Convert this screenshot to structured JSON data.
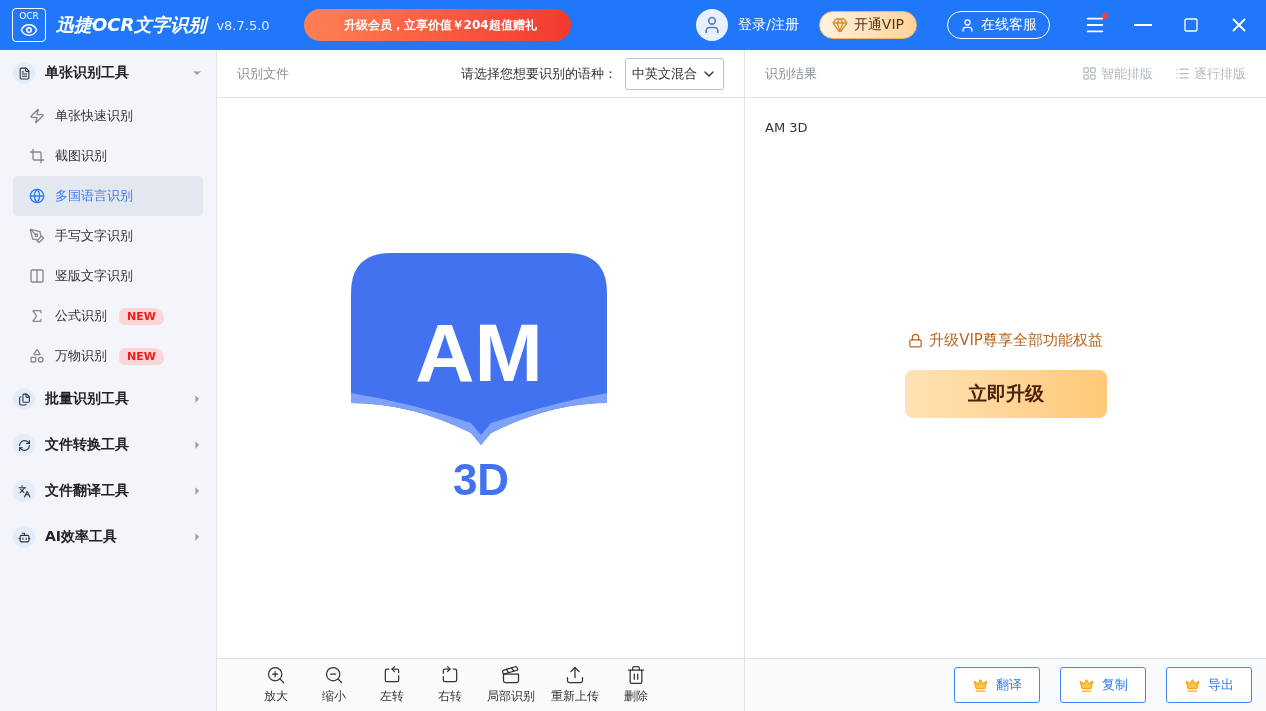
{
  "app": {
    "logo_text": "OCR",
    "title": "迅捷OCR文字识别",
    "version": "v8.7.5.0",
    "promo": "升级会员，立享价值￥204超值赠礼",
    "login": "登录/注册",
    "vip": "开通VIP",
    "service": "在线客服",
    "menu_has_dot": true
  },
  "sidebar": [
    {
      "label": "单张识别工具",
      "expanded": true,
      "children": [
        {
          "label": "单张快速识别",
          "selected": false
        },
        {
          "label": "截图识别",
          "selected": false
        },
        {
          "label": "多国语言识别",
          "selected": true
        },
        {
          "label": "手写文字识别",
          "selected": false
        },
        {
          "label": "竖版文字识别",
          "selected": false
        },
        {
          "label": "公式识别",
          "selected": false,
          "badge": "NEW"
        },
        {
          "label": "万物识别",
          "selected": false,
          "badge": "NEW"
        }
      ]
    },
    {
      "label": "批量识别工具",
      "expanded": false
    },
    {
      "label": "文件转换工具",
      "expanded": false
    },
    {
      "label": "文件翻译工具",
      "expanded": false
    },
    {
      "label": "AI效率工具",
      "expanded": false
    }
  ],
  "source": {
    "title": "识别文件",
    "language_label": "请选择您想要识别的语种：",
    "language": "中英文混合",
    "preview": {
      "title": "AM",
      "subtitle": "3D"
    },
    "tools": [
      "放大",
      "缩小",
      "左转",
      "右转",
      "局部识别",
      "重新上传",
      "删除"
    ]
  },
  "result": {
    "title": "识别结果",
    "layouts": [
      "智能排版",
      "逐行排版"
    ],
    "text": "AM 3D",
    "notice": "升级VIP尊享全部功能权益",
    "upgrade": "立即升级",
    "actions": [
      "翻译",
      "复制",
      "导出"
    ]
  }
}
